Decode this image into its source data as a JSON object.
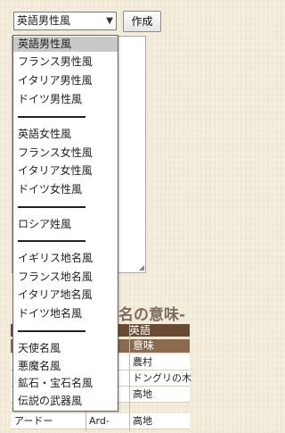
{
  "form": {
    "select_value": "英語男性風",
    "button_label": "作成"
  },
  "heading": "名の意味-",
  "table": {
    "header_lang": "英語",
    "col_meaning": "意味",
    "rows": [
      {
        "a": "",
        "b": "",
        "c": "農村"
      },
      {
        "a": "",
        "b": "",
        "c": "ドングリの木"
      },
      {
        "a": "",
        "b": "",
        "c": "高地"
      },
      {
        "a": "アードー",
        "b": "Ard-",
        "c": "高地"
      }
    ]
  },
  "dropdown": {
    "options": [
      "英語男性風",
      "フランス男性風",
      "イタリア男性風",
      "ドイツ男性風",
      "英語女性風",
      "フランス女性風",
      "イタリア女性風",
      "ドイツ女性風",
      "ロシア姓風",
      "イギリス地名風",
      "フランス地名風",
      "イタリア地名風",
      "ドイツ地名風",
      "天使名風",
      "悪魔名風",
      "鉱石・宝石名風",
      "伝説の武器風"
    ],
    "selected_index": 0
  }
}
